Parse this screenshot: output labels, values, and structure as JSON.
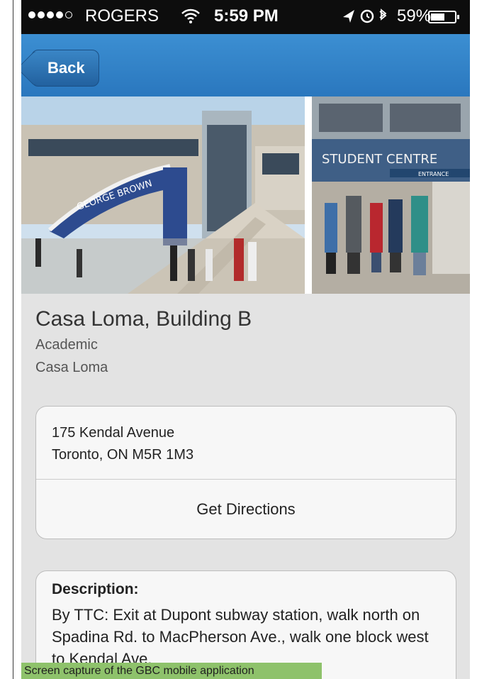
{
  "status_bar": {
    "carrier": "ROGERS",
    "time": "5:59 PM",
    "battery_percent": "59%",
    "battery_level": 0.59,
    "signal_bars_filled": 4,
    "signal_bars_total": 5
  },
  "nav": {
    "back_label": "Back"
  },
  "building": {
    "name": "Casa Loma, Building B",
    "category": "Academic",
    "campus": "Casa Loma"
  },
  "photos": {
    "left_sign": "GEORGE BROWN",
    "right_sign": "STUDENT CENTRE",
    "right_sign_sub": "ENTRANCE"
  },
  "address": {
    "line1": "175 Kendal Avenue",
    "line2": "Toronto, ON  M5R 1M3",
    "directions_label": "Get Directions"
  },
  "description": {
    "heading": "Description:",
    "text": "By TTC: Exit at Dupont subway station, walk north on Spadina Rd. to MacPherson Ave., walk one block west to Kendal Ave."
  },
  "caption": "Screen capture of the GBC mobile application",
  "colors": {
    "nav_blue": "#2f80c5",
    "status_black": "#0d0d0d",
    "caption_green": "#8ec26b",
    "background_gray": "#e3e3e3"
  }
}
